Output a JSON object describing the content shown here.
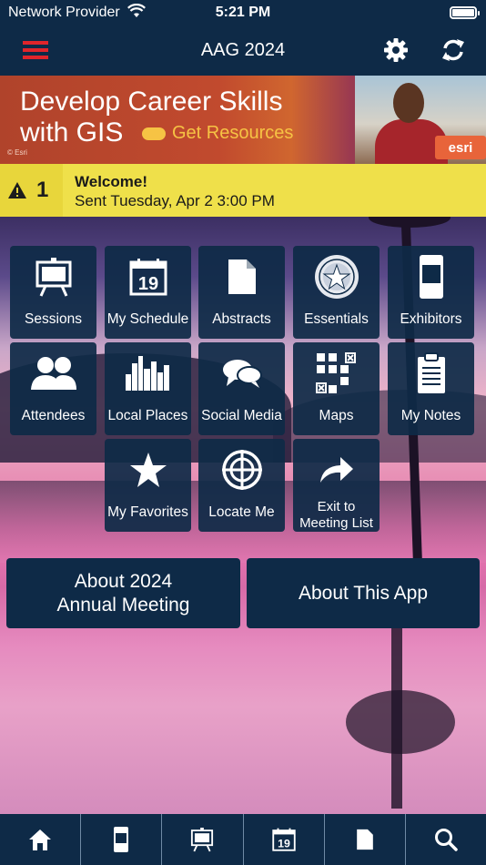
{
  "status_bar": {
    "carrier": "Network Provider",
    "time": "5:21 PM"
  },
  "nav": {
    "title": "AAG 2024",
    "menu_icon": "hamburger-menu-icon",
    "settings_icon": "gear-icon",
    "refresh_icon": "refresh-icon"
  },
  "banner": {
    "line1": "Develop Career Skills",
    "line2": "with GIS",
    "cta": "Get Resources",
    "brand": "esri",
    "copyright": "© Esri"
  },
  "alert": {
    "count": "1",
    "title": "Welcome!",
    "message": "Sent Tuesday, Apr 2 3:00 PM",
    "icon": "warning-icon"
  },
  "grid": {
    "sessions": "Sessions",
    "schedule": "My Schedule",
    "schedule_day": "19",
    "abstracts": "Abstracts",
    "essentials": "Essentials",
    "exhibitors": "Exhibitors",
    "attendees": "Attendees",
    "local_places": "Local Places",
    "social_media": "Social Media",
    "maps": "Maps",
    "notes": "My Notes",
    "favorites": "My Favorites",
    "locate": "Locate Me",
    "exit_line1": "Exit to",
    "exit_line2": "Meeting List"
  },
  "buttons": {
    "about_meeting_line1": "About 2024",
    "about_meeting_line2": "Annual Meeting",
    "about_app": "About This App"
  },
  "tabbar": {
    "items": [
      "home-icon",
      "exhibitor-icon",
      "sessions-icon",
      "calendar-icon",
      "document-icon",
      "search-icon"
    ],
    "calendar_day": "19"
  },
  "colors": {
    "navy": "#0e2a47",
    "alert_yellow": "#efe04a",
    "accent_red": "#e0252b",
    "cta_gold": "#f6c344"
  }
}
